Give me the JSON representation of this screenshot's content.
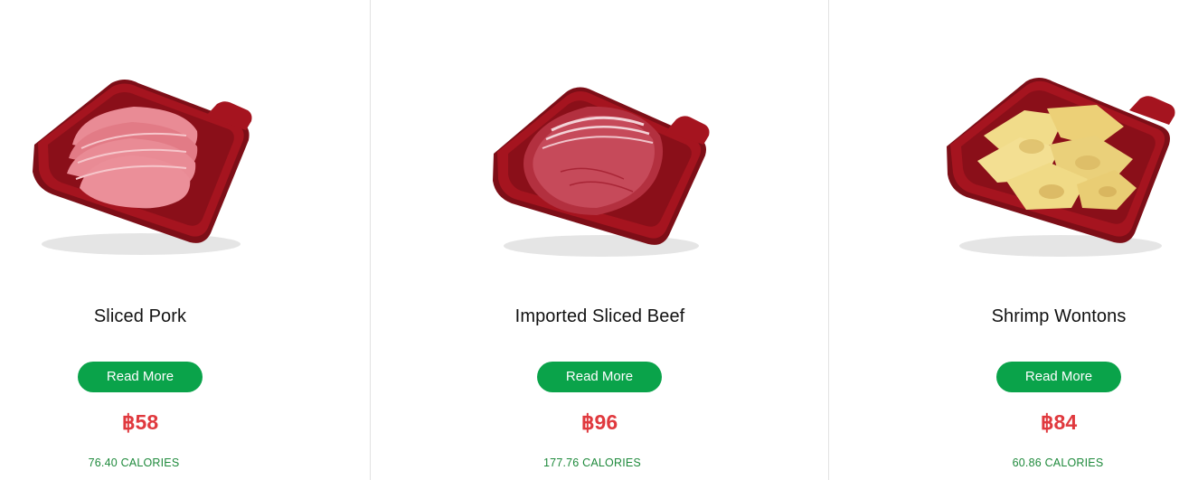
{
  "items": [
    {
      "name": "Sliced Pork",
      "button_label": "Read More",
      "price": "฿58",
      "calories": "76.40 CALORIES",
      "image": "sliced-pork-tray"
    },
    {
      "name": "Imported Sliced Beef",
      "button_label": "Read More",
      "price": "฿96",
      "calories": "177.76 CALORIES",
      "image": "sliced-beef-tray"
    },
    {
      "name": "Shrimp Wontons",
      "button_label": "Read More",
      "price": "฿84",
      "calories": "60.86 CALORIES",
      "image": "shrimp-wontons-tray"
    }
  ],
  "colors": {
    "button": "#0aa34a",
    "price": "#e0393e",
    "calories": "#1f8a3c",
    "tray": "#9e1520"
  }
}
